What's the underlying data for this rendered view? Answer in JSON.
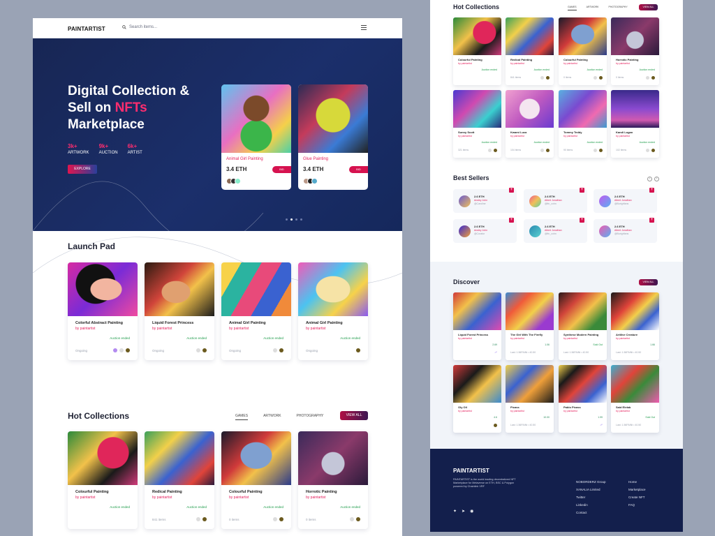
{
  "brand": "PAINTARTIST",
  "search_placeholder": "Search items...",
  "hero": {
    "line1": "Digital Collection &",
    "line2_pre": "Sell on ",
    "line2_hl": "NFTs",
    "line3": "Marketplace",
    "stats": [
      {
        "num": "3k+",
        "label": "ARTWORK"
      },
      {
        "num": "9k+",
        "label": "AUCTION"
      },
      {
        "num": "6k+",
        "label": "ARTIST"
      }
    ],
    "explore": "EXPLORE",
    "cards": [
      {
        "name": "Animal Girl Painting",
        "price": "3.4 ETH",
        "bid": "BID"
      },
      {
        "name": "Glue Painting",
        "price": "3.4 ETH",
        "bid": "BID"
      }
    ]
  },
  "launchpad": {
    "title": "Launch Pad",
    "cards": [
      {
        "title": "Colorful Abstract Painting",
        "by": "by  paintartist",
        "status": "Auction ended",
        "foot": "Ongoing"
      },
      {
        "title": "Liquid Forest Princess",
        "by": "by  paintartist",
        "status": "Auction ended",
        "foot": "Ongoing"
      },
      {
        "title": "Animal Girl Painting",
        "by": "by  paintartist",
        "status": "Auction ended",
        "foot": "Ongoing"
      },
      {
        "title": "Animal Girl Painting",
        "by": "by  paintartist",
        "status": "Auction ended",
        "foot": "Ongoing"
      }
    ]
  },
  "hot": {
    "title": "Hot Collections",
    "tabs": [
      "GAMES",
      "ARTWORK",
      "PHOTOGRAPHY"
    ],
    "view_all": "VIEW ALL",
    "cards": [
      {
        "title": "Colourful Painting",
        "by": "by  paintartist",
        "status": "Auction ended",
        "foot": ""
      },
      {
        "title": "Redical Painting",
        "by": "by  paintartist",
        "status": "Auction ended",
        "foot": "841 items"
      },
      {
        "title": "Colourful Painting",
        "by": "by  paintartist",
        "status": "Auction ended",
        "foot": "0 items"
      },
      {
        "title": "Horrotic Painting",
        "by": "by  paintartist",
        "status": "Auction ended",
        "foot": "0 items"
      }
    ]
  },
  "right": {
    "hot_title": "Hot Collections",
    "tabs": [
      "GAMES",
      "ARTWORK",
      "PHOTOGRAPHY"
    ],
    "view_all": "VIEW ALL",
    "hot_cards": [
      {
        "title": "Colourful Painting",
        "by": "by  paintartist",
        "status": "Auction ended",
        "foot": ""
      },
      {
        "title": "Redical Painting",
        "by": "by  paintartist",
        "status": "Auction ended",
        "foot": "841 items"
      },
      {
        "title": "Colourful Painting",
        "by": "by  paintartist",
        "status": "Auction ended",
        "foot": "0 items"
      },
      {
        "title": "Horrotic Painting",
        "by": "by  paintartist",
        "status": "Auction ended",
        "foot": "0 items"
      },
      {
        "title": "Sunny Scott",
        "by": "by  paintartist",
        "status": "Auction ended",
        "foot": "321 items"
      },
      {
        "title": "Kwami Luca",
        "by": "by  paintartist",
        "status": "Auction ended",
        "foot": "104 items"
      },
      {
        "title": "Tommy Teddy",
        "by": "by  paintartist",
        "status": "Auction ended",
        "foot": "90 items"
      },
      {
        "title": "Kandi Logan",
        "by": "by  paintartist",
        "status": "Auction ended",
        "foot": "102 items"
      }
    ],
    "sellers_title": "Best Sellers",
    "sellers": [
      {
        "price": "2.6 ETH",
        "name": "Ansley John",
        "handle": "@Caroline"
      },
      {
        "price": "2.6 ETH",
        "name": "Albert Jonathan",
        "handle": "@fin_cohn"
      },
      {
        "price": "2.6 ETH",
        "name": "Albert Jonathan",
        "handle": "@Burighfans"
      },
      {
        "price": "2.6 ETH",
        "name": "Ansley John",
        "handle": "@Curator"
      },
      {
        "price": "2.6 ETH",
        "name": "Albert Jonathan",
        "handle": "@fin_cohn"
      },
      {
        "price": "2.6 ETH",
        "name": "Albert Jonathan",
        "handle": "@Burighfans"
      }
    ],
    "discover_title": "Discover",
    "discover_view_all": "VIEW ALL",
    "discover_cards": [
      {
        "title": "Liquid Forest Princess",
        "by": "by  paintartist",
        "price": "2.69",
        "foot": ""
      },
      {
        "title": "The Girl With The Firefly",
        "by": "by  paintartist",
        "price": "1.06",
        "foot": "Last: 1.56PAINt • 40.50"
      },
      {
        "title": "Synthese Modern Painting",
        "by": "by  paintartist",
        "price": "Sold Out",
        "foot": "Last: 1.56PAINt • 40.50"
      },
      {
        "title": "Artilive Creature",
        "by": "by  paintartist",
        "price": "1.66",
        "foot": "Last: 1.56PAINt • 40.50"
      },
      {
        "title": "Oly Oil",
        "by": "by  paintartist",
        "price": "4.6",
        "foot": ""
      },
      {
        "title": "Picass",
        "by": "by  paintartist",
        "price": "10.00",
        "foot": "Last: 1.56PAINt • 40.50"
      },
      {
        "title": "Pablo Picass",
        "by": "by  paintartist",
        "price": "1.99",
        "foot": ""
      },
      {
        "title": "Said Elelab",
        "by": "by  paintartist",
        "price": "Sold Out",
        "foot": "Last: 1.56PAINt • 40.50"
      }
    ],
    "footer": {
      "logo": "PAINTARTIST",
      "desc": "PAINTARTIST is the world leading decentralized NFT Marketplace for Metaverse on ETH, BSC & Polygon powered by Chainlink VRF",
      "col1": [
        "NOBORDERZ Group",
        "XANALIA Limited",
        "Twitter",
        "Linkedin",
        "Contact"
      ],
      "col2": [
        "Home",
        "Marketplace",
        "Create NFT",
        "FAQ"
      ]
    }
  }
}
